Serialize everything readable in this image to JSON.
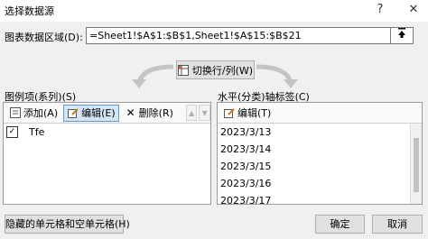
{
  "window": {
    "title": "选择数据源",
    "help_label": "?",
    "close_label": "✕"
  },
  "range": {
    "label": "图表数据区域(D):",
    "value": "=Sheet1!$A$1:$B$1,Sheet1!$A$15:$B$21"
  },
  "switch_button": {
    "label": "切换行/列(W)"
  },
  "legend": {
    "header": "图例项(系列)(S)",
    "add_label": "添加(A)",
    "edit_label": "编辑(E)",
    "delete_label": "删除(R)",
    "items": [
      {
        "label": "Tfe",
        "checked": true
      }
    ]
  },
  "axis": {
    "header": "水平(分类)轴标签(C)",
    "edit_label": "编辑(T)",
    "items": [
      "2023/3/13",
      "2023/3/14",
      "2023/3/15",
      "2023/3/16",
      "2023/3/17"
    ]
  },
  "footer": {
    "hidden_cells_label": "隐藏的单元格和空单元格(H)",
    "ok_label": "确定",
    "cancel_label": "取消"
  }
}
